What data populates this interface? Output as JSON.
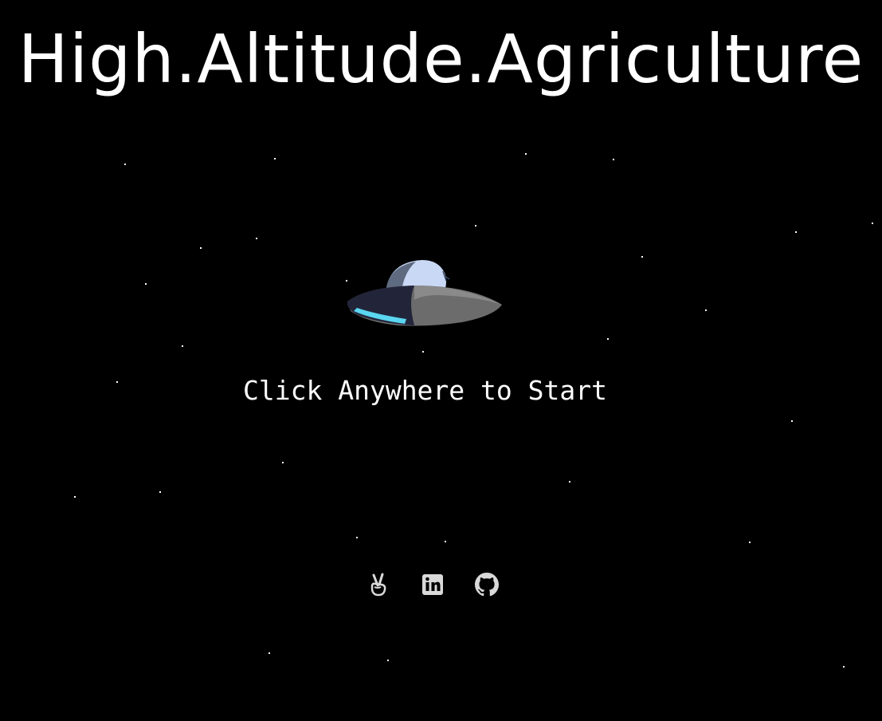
{
  "title": "High.Altitude.Agriculture",
  "prompt": "Click Anywhere to Start",
  "colors": {
    "background": "#000000",
    "text": "#ffffff",
    "icon": "#d9d9d9",
    "ufo_dome": "#c9d8f5",
    "ufo_body": "#6a6a6a",
    "ufo_shadow": "#2a2a3e",
    "ufo_light": "#5ad6f0"
  },
  "social_links": [
    {
      "icon": "angellist-icon",
      "label": "AngelList"
    },
    {
      "icon": "linkedin-icon",
      "label": "LinkedIn"
    },
    {
      "icon": "github-icon",
      "label": "GitHub"
    }
  ]
}
